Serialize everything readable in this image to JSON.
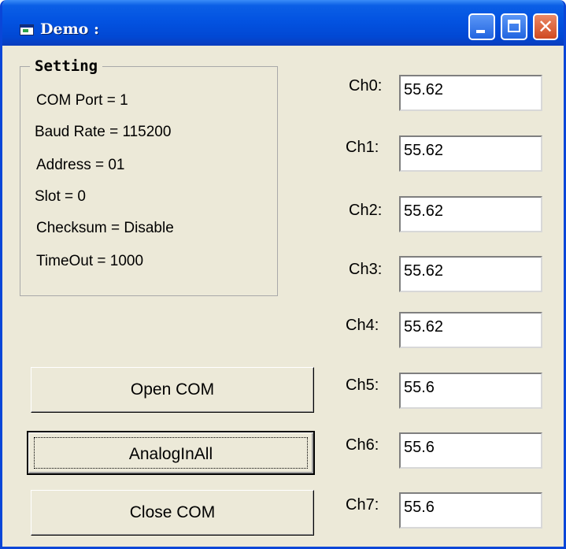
{
  "window": {
    "title": "Demo :"
  },
  "settings": {
    "legend": "Setting",
    "items": [
      "COM Port = 1",
      "Baud Rate = 115200",
      "Address = 01",
      "Slot = 0",
      "Checksum = Disable",
      "TimeOut = 1000"
    ]
  },
  "buttons": {
    "open": "Open COM",
    "analog": "AnalogInAll",
    "close": "Close COM"
  },
  "channels": [
    {
      "label": "Ch0:",
      "value": "55.62"
    },
    {
      "label": "Ch1:",
      "value": "55.62"
    },
    {
      "label": "Ch2:",
      "value": "55.62"
    },
    {
      "label": "Ch3:",
      "value": "55.62"
    },
    {
      "label": "Ch4:",
      "value": "55.62"
    },
    {
      "label": "Ch5:",
      "value": "55.6"
    },
    {
      "label": "Ch6:",
      "value": "55.6"
    },
    {
      "label": "Ch7:",
      "value": "55.6"
    }
  ],
  "icons": {
    "app": "app-window-icon",
    "minimize": "minimize-icon",
    "maximize": "maximize-icon",
    "close": "close-icon"
  }
}
